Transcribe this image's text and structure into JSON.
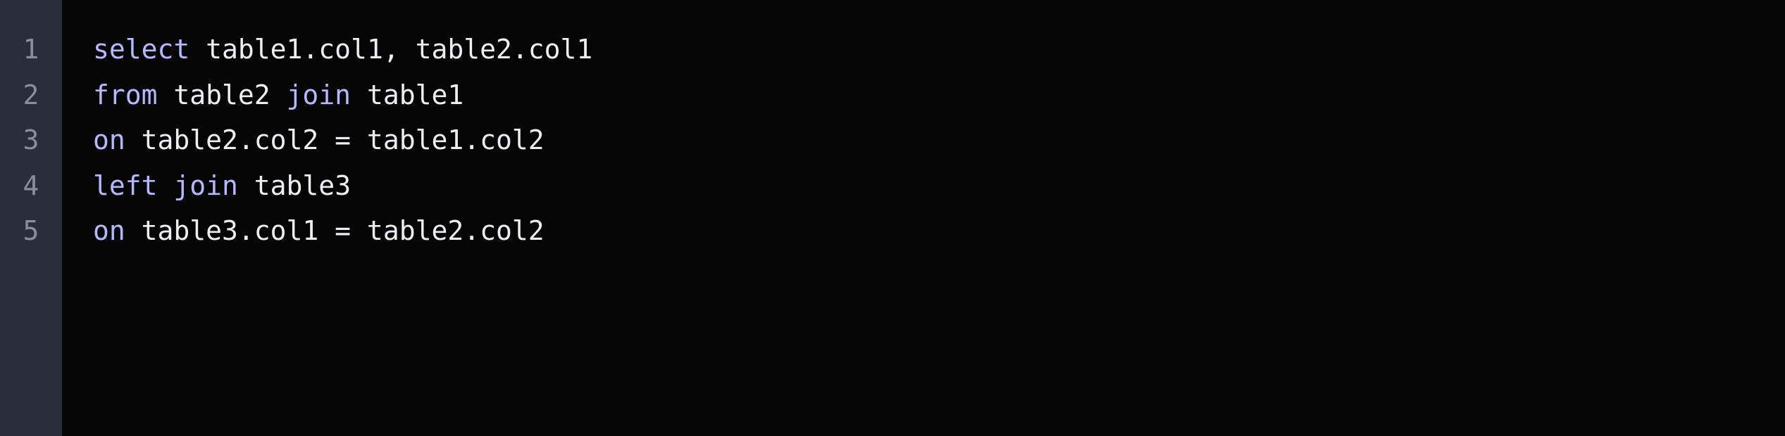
{
  "editor": {
    "lines": [
      {
        "num": "1",
        "tokens": [
          {
            "t": "select",
            "c": "kw"
          },
          {
            "t": " table1.col1, table2.col1",
            "c": ""
          }
        ]
      },
      {
        "num": "2",
        "tokens": [
          {
            "t": "from",
            "c": "kw"
          },
          {
            "t": " table2 ",
            "c": ""
          },
          {
            "t": "join",
            "c": "kw"
          },
          {
            "t": " table1",
            "c": ""
          }
        ]
      },
      {
        "num": "3",
        "tokens": [
          {
            "t": "on",
            "c": "kw"
          },
          {
            "t": " table2.col2 = table1.col2",
            "c": ""
          }
        ]
      },
      {
        "num": "4",
        "tokens": [
          {
            "t": "left",
            "c": "kw"
          },
          {
            "t": " ",
            "c": ""
          },
          {
            "t": "join",
            "c": "kw"
          },
          {
            "t": " table3",
            "c": ""
          }
        ]
      },
      {
        "num": "5",
        "tokens": [
          {
            "t": "on",
            "c": "kw"
          },
          {
            "t": " table3.col1 = table2.col2",
            "c": ""
          }
        ]
      }
    ]
  }
}
